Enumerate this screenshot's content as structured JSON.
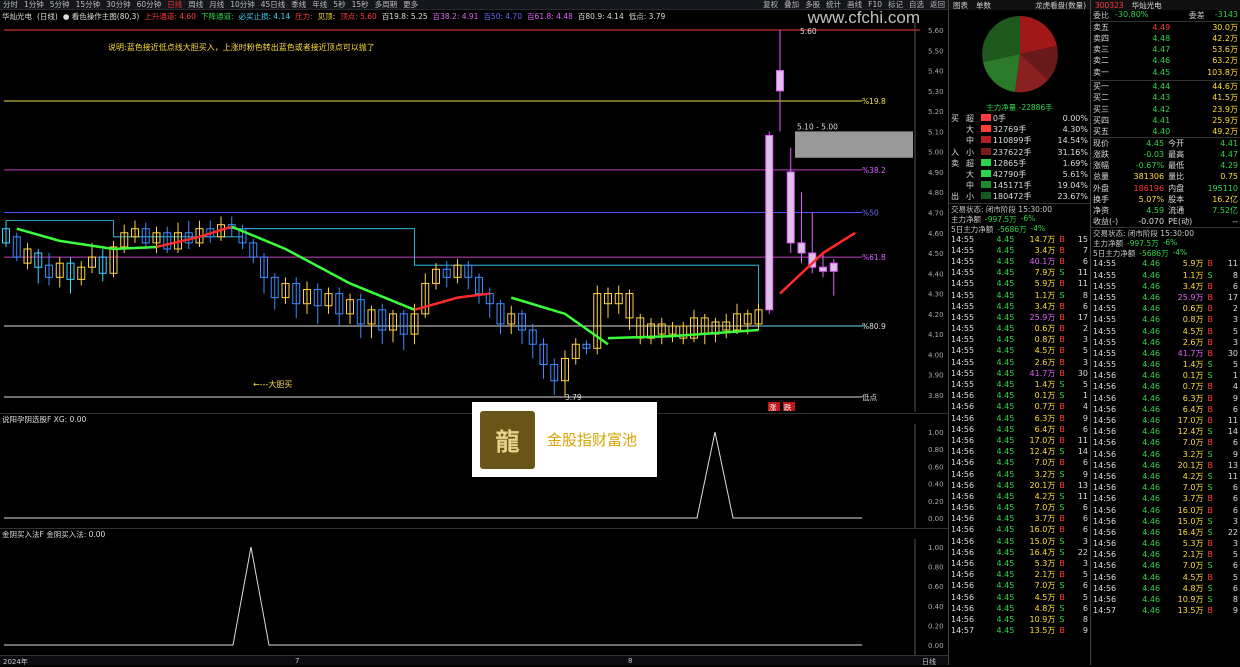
{
  "topbar": {
    "stock_name": "华灿光电",
    "periods": [
      "分时",
      "1分钟",
      "5分钟",
      "15分钟",
      "30分钟",
      "60分钟",
      "日线",
      "周线",
      "月线",
      "10分钟",
      "45日线",
      "季线",
      "年线",
      "5秒",
      "15秒",
      "多周期",
      "更多"
    ],
    "selected_period": "日线",
    "right_buttons": [
      "复权",
      "叠加",
      "多股",
      "统计",
      "画线",
      "F10",
      "标记",
      "自选",
      "返回"
    ]
  },
  "indicator_line": {
    "period_label": "(日线)",
    "indicator_name": "● 看色操作主图(80,3)",
    "items": [
      {
        "text": "上升通道: 4.60",
        "color": "#ff3b3b"
      },
      {
        "text": "下降通道:",
        "color": "#2fd64a"
      },
      {
        "text": "必买止损: 4.14",
        "color": "#3bd6ff"
      },
      {
        "text": "压力:",
        "color": "#ff3b3b"
      },
      {
        "text": "见顶:",
        "color": "#ffde3b"
      },
      {
        "text": "顶点: 5.60",
        "color": "#ff3b3b"
      },
      {
        "text": "百19.8: 5.25",
        "color": "#ddd"
      },
      {
        "text": "百38.2: 4.91",
        "color": "#e060ff"
      },
      {
        "text": "百50: 4.70",
        "color": "#6666ff"
      },
      {
        "text": "百61.8: 4.48",
        "color": "#e060ff"
      },
      {
        "text": "百80.9: 4.14",
        "color": "#ddd"
      },
      {
        "text": "低点: 3.79",
        "color": "#ddd"
      }
    ]
  },
  "annotation": "说明:蓝色接近低点线大胆买入，上涨时粉色转出蓝色或者接近顶点可以抛了",
  "annotation_low": "←---大胆买",
  "watermark": "www.cfchi.com",
  "stamp_text": "金股指财富池",
  "seal_glyph": "龍",
  "main_yaxis": [
    "5.60",
    "5.50",
    "5.40",
    "5.30",
    "5.20",
    "5.10",
    "5.00",
    "4.90",
    "4.80",
    "4.70",
    "4.60",
    "4.50",
    "4.40",
    "4.30",
    "4.20",
    "4.10",
    "4.00",
    "3.90",
    "3.80"
  ],
  "fib_labels": [
    "%19.8",
    "%38.2",
    "%50",
    "%61.8",
    "%80.9",
    "低点"
  ],
  "price_tags": {
    "high": "5.60",
    "range": "5.10 - 5.00",
    "low": "3.79"
  },
  "chips_labels": [
    "涨",
    "跌"
  ],
  "sub1": {
    "label": "说阳孕阴选股F XG: 0.00",
    "yaxis": [
      "1.00",
      "0.80",
      "0.60",
      "0.40",
      "0.20",
      "0.00"
    ]
  },
  "sub2": {
    "label": "金阴买入法F 金阴买入法: 0.00",
    "yaxis": [
      "1.00",
      "0.80",
      "0.60",
      "0.40",
      "0.20",
      "0.00"
    ]
  },
  "xaxis": {
    "labels": [
      "2024年",
      "7",
      "8"
    ],
    "right": "日线"
  },
  "flow_panel": {
    "header": [
      "图表",
      "单数"
    ],
    "title": "龙虎看盘(数量)",
    "pie_label": "主力净量 -22886手",
    "buy_rows": [
      {
        "side": "买",
        "cat": "超",
        "vol": "0手",
        "pct": "0.00%"
      },
      {
        "side": "",
        "cat": "大",
        "vol": "32769手",
        "pct": "4.30%"
      },
      {
        "side": "",
        "cat": "中",
        "vol": "110899手",
        "pct": "14.54%"
      },
      {
        "side": "入",
        "cat": "小",
        "vol": "237622手",
        "pct": "31.16%"
      }
    ],
    "sell_rows": [
      {
        "side": "卖",
        "cat": "超",
        "vol": "12865手",
        "pct": "1.69%"
      },
      {
        "side": "",
        "cat": "大",
        "vol": "42790手",
        "pct": "5.61%"
      },
      {
        "side": "",
        "cat": "中",
        "vol": "145171手",
        "pct": "19.04%"
      },
      {
        "side": "出",
        "cat": "小",
        "vol": "180472手",
        "pct": "23.67%"
      }
    ],
    "status": "交易状态: 闭市阶段 15:30:00",
    "net1_label": "主力净额",
    "net1_val": "-997.5万",
    "net1_pct": "-6%",
    "net2_label": "5日主力净额",
    "net2_val": "-5686万",
    "net2_pct": "-4%"
  },
  "ticks_mid": [
    [
      "14:55",
      "4.45",
      "14.7万",
      "B",
      "15"
    ],
    [
      "14:55",
      "4.45",
      "3.4万",
      "B",
      "7"
    ],
    [
      "14:55",
      "4.45",
      "40.1万",
      "B",
      "6"
    ],
    [
      "14:55",
      "4.45",
      "7.9万",
      "S",
      "11"
    ],
    [
      "14:55",
      "4.45",
      "5.9万",
      "B",
      "11"
    ],
    [
      "14:55",
      "4.45",
      "1.1万",
      "S",
      "8"
    ],
    [
      "14:55",
      "4.45",
      "3.4万",
      "B",
      "6"
    ],
    [
      "14:55",
      "4.45",
      "25.9万",
      "B",
      "17"
    ],
    [
      "14:55",
      "4.45",
      "0.6万",
      "B",
      "2"
    ],
    [
      "14:55",
      "4.45",
      "0.8万",
      "B",
      "3"
    ],
    [
      "14:55",
      "4.45",
      "4.5万",
      "B",
      "5"
    ],
    [
      "14:55",
      "4.45",
      "2.6万",
      "B",
      "3"
    ],
    [
      "14:55",
      "4.45",
      "41.7万",
      "B",
      "30"
    ],
    [
      "14:55",
      "4.45",
      "1.4万",
      "S",
      "5"
    ],
    [
      "14:56",
      "4.45",
      "0.1万",
      "S",
      "1"
    ],
    [
      "14:56",
      "4.45",
      "0.7万",
      "B",
      "4"
    ],
    [
      "14:56",
      "4.45",
      "6.3万",
      "B",
      "9"
    ],
    [
      "14:56",
      "4.45",
      "6.4万",
      "B",
      "6"
    ],
    [
      "14:56",
      "4.45",
      "17.0万",
      "B",
      "11"
    ],
    [
      "14:56",
      "4.45",
      "12.4万",
      "S",
      "14"
    ],
    [
      "14:56",
      "4.45",
      "7.0万",
      "B",
      "6"
    ],
    [
      "14:56",
      "4.45",
      "3.2万",
      "S",
      "9"
    ],
    [
      "14:56",
      "4.45",
      "20.1万",
      "B",
      "13"
    ],
    [
      "14:56",
      "4.45",
      "4.2万",
      "S",
      "11"
    ],
    [
      "14:56",
      "4.45",
      "7.0万",
      "S",
      "6"
    ],
    [
      "14:56",
      "4.45",
      "3.7万",
      "B",
      "6"
    ],
    [
      "14:56",
      "4.45",
      "16.0万",
      "B",
      "6"
    ],
    [
      "14:56",
      "4.45",
      "15.0万",
      "S",
      "3"
    ],
    [
      "14:56",
      "4.45",
      "16.4万",
      "S",
      "22"
    ],
    [
      "14:56",
      "4.45",
      "5.3万",
      "B",
      "3"
    ],
    [
      "14:56",
      "4.45",
      "2.1万",
      "B",
      "5"
    ],
    [
      "14:56",
      "4.45",
      "7.0万",
      "S",
      "6"
    ],
    [
      "14:56",
      "4.45",
      "4.5万",
      "B",
      "5"
    ],
    [
      "14:56",
      "4.45",
      "4.8万",
      "S",
      "6"
    ],
    [
      "14:56",
      "4.45",
      "10.9万",
      "S",
      "8"
    ],
    [
      "14:57",
      "4.45",
      "13.5万",
      "B",
      "9"
    ]
  ],
  "quote": {
    "code": "300323",
    "name": "华灿光电",
    "weibi_label": "委比",
    "weibi": "-30.80%",
    "weicha_label": "委差",
    "weicha": "-3143",
    "sells": [
      {
        "label": "卖五",
        "price": "4.49",
        "vol": "30.0万"
      },
      {
        "label": "卖四",
        "price": "4.48",
        "vol": "42.2万"
      },
      {
        "label": "卖三",
        "price": "4.47",
        "vol": "53.6万"
      },
      {
        "label": "卖二",
        "price": "4.46",
        "vol": "63.2万"
      },
      {
        "label": "卖一",
        "price": "4.45",
        "vol": "103.8万"
      }
    ],
    "buys": [
      {
        "label": "买一",
        "price": "4.44",
        "vol": "44.6万"
      },
      {
        "label": "买二",
        "price": "4.43",
        "vol": "41.5万"
      },
      {
        "label": "买三",
        "price": "4.42",
        "vol": "23.9万"
      },
      {
        "label": "买四",
        "price": "4.41",
        "vol": "25.9万"
      },
      {
        "label": "买五",
        "price": "4.40",
        "vol": "49.2万"
      }
    ],
    "stats": [
      [
        "现价",
        "4.45",
        "今开",
        "4.41"
      ],
      [
        "涨跌",
        "-0.03",
        "最高",
        "4.47"
      ],
      [
        "涨幅",
        "-0.67%",
        "最低",
        "4.29"
      ],
      [
        "总量",
        "381306",
        "量比",
        "0.75"
      ],
      [
        "外盘",
        "186196",
        "内盘",
        "195110"
      ],
      [
        "换手",
        "5.07%",
        "股本",
        "16.2亿"
      ],
      [
        "净资",
        "4.59",
        "流通",
        "7.52亿"
      ],
      [
        "收益(-)",
        "-0.070",
        "PE(动)",
        "--"
      ]
    ],
    "status": "交易状态: 闭市阶段 15:30:00",
    "net1_label": "主力净额",
    "net1_val": "-997.5万",
    "net1_pct": "-6%",
    "net2_label": "5日主力净额",
    "net2_val": "-5686万",
    "net2_pct": "-4%"
  },
  "ticks_right": [
    [
      "14:55",
      "4.46",
      "5.9万",
      "B",
      "11"
    ],
    [
      "14:55",
      "4.46",
      "1.1万",
      "S",
      "8"
    ],
    [
      "14:55",
      "4.46",
      "3.4万",
      "B",
      "6"
    ],
    [
      "14:55",
      "4.46",
      "25.9万",
      "B",
      "17"
    ],
    [
      "14:55",
      "4.46",
      "0.6万",
      "B",
      "2"
    ],
    [
      "14:55",
      "4.46",
      "0.8万",
      "B",
      "3"
    ],
    [
      "14:55",
      "4.46",
      "4.5万",
      "B",
      "5"
    ],
    [
      "14:55",
      "4.46",
      "2.6万",
      "B",
      "3"
    ],
    [
      "14:55",
      "4.46",
      "41.7万",
      "B",
      "30"
    ],
    [
      "14:55",
      "4.46",
      "1.4万",
      "S",
      "5"
    ],
    [
      "14:56",
      "4.46",
      "0.1万",
      "S",
      "1"
    ],
    [
      "14:56",
      "4.46",
      "0.7万",
      "B",
      "4"
    ],
    [
      "14:56",
      "4.46",
      "6.3万",
      "B",
      "9"
    ],
    [
      "14:56",
      "4.46",
      "6.4万",
      "B",
      "6"
    ],
    [
      "14:56",
      "4.46",
      "17.0万",
      "B",
      "11"
    ],
    [
      "14:56",
      "4.46",
      "12.4万",
      "S",
      "14"
    ],
    [
      "14:56",
      "4.46",
      "7.0万",
      "B",
      "6"
    ],
    [
      "14:56",
      "4.46",
      "3.2万",
      "S",
      "9"
    ],
    [
      "14:56",
      "4.46",
      "20.1万",
      "B",
      "13"
    ],
    [
      "14:56",
      "4.46",
      "4.2万",
      "S",
      "11"
    ],
    [
      "14:56",
      "4.46",
      "7.0万",
      "S",
      "6"
    ],
    [
      "14:56",
      "4.46",
      "3.7万",
      "B",
      "6"
    ],
    [
      "14:56",
      "4.46",
      "16.0万",
      "B",
      "6"
    ],
    [
      "14:56",
      "4.46",
      "15.0万",
      "S",
      "3"
    ],
    [
      "14:56",
      "4.46",
      "16.4万",
      "S",
      "22"
    ],
    [
      "14:56",
      "4.46",
      "5.3万",
      "B",
      "3"
    ],
    [
      "14:56",
      "4.46",
      "2.1万",
      "B",
      "5"
    ],
    [
      "14:56",
      "4.46",
      "7.0万",
      "S",
      "6"
    ],
    [
      "14:56",
      "4.46",
      "4.5万",
      "B",
      "5"
    ],
    [
      "14:56",
      "4.46",
      "4.8万",
      "S",
      "6"
    ],
    [
      "14:56",
      "4.46",
      "10.9万",
      "S",
      "8"
    ],
    [
      "14:57",
      "4.46",
      "13.5万",
      "B",
      "9"
    ]
  ],
  "candles": [
    [
      4.55,
      4.62,
      4.66,
      4.53
    ],
    [
      4.58,
      4.48,
      4.6,
      4.46
    ],
    [
      4.45,
      4.52,
      4.55,
      4.42
    ],
    [
      4.5,
      4.43,
      4.52,
      4.35
    ],
    [
      4.44,
      4.38,
      4.5,
      4.34
    ],
    [
      4.38,
      4.45,
      4.48,
      4.33
    ],
    [
      4.45,
      4.37,
      4.48,
      4.3
    ],
    [
      4.37,
      4.43,
      4.46,
      4.34
    ],
    [
      4.43,
      4.48,
      4.55,
      4.4
    ],
    [
      4.48,
      4.4,
      4.52,
      4.36
    ],
    [
      4.4,
      4.53,
      4.56,
      4.38
    ],
    [
      4.53,
      4.6,
      4.64,
      4.5
    ],
    [
      4.58,
      4.62,
      4.66,
      4.55
    ],
    [
      4.62,
      4.55,
      4.65,
      4.52
    ],
    [
      4.55,
      4.6,
      4.63,
      4.5
    ],
    [
      4.6,
      4.52,
      4.63,
      4.5
    ],
    [
      4.52,
      4.6,
      4.65,
      4.5
    ],
    [
      4.6,
      4.55,
      4.66,
      4.52
    ],
    [
      4.55,
      4.62,
      4.66,
      4.53
    ],
    [
      4.62,
      4.58,
      4.66,
      4.55
    ],
    [
      4.58,
      4.64,
      4.68,
      4.56
    ],
    [
      4.64,
      4.62,
      4.68,
      4.58
    ],
    [
      4.62,
      4.55,
      4.64,
      4.52
    ],
    [
      4.55,
      4.48,
      4.57,
      4.45
    ],
    [
      4.48,
      4.38,
      4.5,
      4.3
    ],
    [
      4.38,
      4.28,
      4.4,
      4.22
    ],
    [
      4.28,
      4.35,
      4.38,
      4.25
    ],
    [
      4.35,
      4.25,
      4.38,
      4.18
    ],
    [
      4.25,
      4.32,
      4.36,
      4.2
    ],
    [
      4.32,
      4.24,
      4.35,
      4.15
    ],
    [
      4.24,
      4.3,
      4.33,
      4.2
    ],
    [
      4.3,
      4.2,
      4.33,
      4.14
    ],
    [
      4.2,
      4.27,
      4.3,
      4.15
    ],
    [
      4.27,
      4.15,
      4.3,
      4.08
    ],
    [
      4.15,
      4.22,
      4.24,
      4.08
    ],
    [
      4.22,
      4.12,
      4.25,
      4.05
    ],
    [
      4.12,
      4.2,
      4.22,
      4.06
    ],
    [
      4.2,
      4.1,
      4.22,
      4.02
    ],
    [
      4.1,
      4.2,
      4.25,
      4.05
    ],
    [
      4.2,
      4.35,
      4.4,
      4.18
    ],
    [
      4.35,
      4.42,
      4.45,
      4.32
    ],
    [
      4.42,
      4.38,
      4.46,
      4.33
    ],
    [
      4.38,
      4.44,
      4.47,
      4.35
    ],
    [
      4.44,
      4.38,
      4.46,
      4.32
    ],
    [
      4.38,
      4.3,
      4.4,
      4.25
    ],
    [
      4.3,
      4.25,
      4.33,
      4.18
    ],
    [
      4.25,
      4.15,
      4.27,
      4.1
    ],
    [
      4.15,
      4.2,
      4.24,
      4.1
    ],
    [
      4.2,
      4.12,
      4.22,
      4.05
    ],
    [
      4.12,
      4.05,
      4.15,
      3.98
    ],
    [
      4.05,
      3.95,
      4.08,
      3.88
    ],
    [
      3.95,
      3.87,
      3.98,
      3.8
    ],
    [
      3.87,
      3.98,
      4.02,
      3.79
    ],
    [
      3.98,
      4.05,
      4.08,
      3.95
    ],
    [
      4.05,
      4.03,
      4.07,
      4.0
    ],
    [
      4.03,
      4.3,
      4.34,
      4.0
    ],
    [
      4.3,
      4.25,
      4.33,
      4.18
    ],
    [
      4.25,
      4.3,
      4.34,
      4.2
    ],
    [
      4.3,
      4.18,
      4.32,
      4.12
    ],
    [
      4.18,
      4.08,
      4.2,
      4.05
    ],
    [
      4.08,
      4.15,
      4.18,
      4.05
    ],
    [
      4.15,
      4.1,
      4.18,
      4.05
    ],
    [
      4.1,
      4.14,
      4.16,
      4.06
    ],
    [
      4.14,
      4.08,
      4.16,
      4.05
    ],
    [
      4.08,
      4.18,
      4.22,
      4.06
    ],
    [
      4.18,
      4.1,
      4.2,
      4.05
    ],
    [
      4.1,
      4.16,
      4.18,
      4.06
    ],
    [
      4.16,
      4.12,
      4.2,
      4.08
    ],
    [
      4.12,
      4.2,
      4.25,
      4.1
    ],
    [
      4.2,
      4.15,
      4.22,
      4.1
    ],
    [
      4.15,
      4.22,
      4.25,
      4.12
    ],
    [
      4.22,
      5.08,
      5.1,
      4.2
    ],
    [
      5.4,
      5.3,
      5.6,
      5.1
    ],
    [
      4.9,
      4.55,
      5.02,
      4.5
    ],
    [
      4.55,
      4.5,
      4.8,
      4.45
    ],
    [
      4.5,
      4.43,
      4.7,
      4.4
    ],
    [
      4.43,
      4.41,
      4.5,
      4.38
    ],
    [
      4.41,
      4.45,
      4.47,
      4.29
    ]
  ]
}
